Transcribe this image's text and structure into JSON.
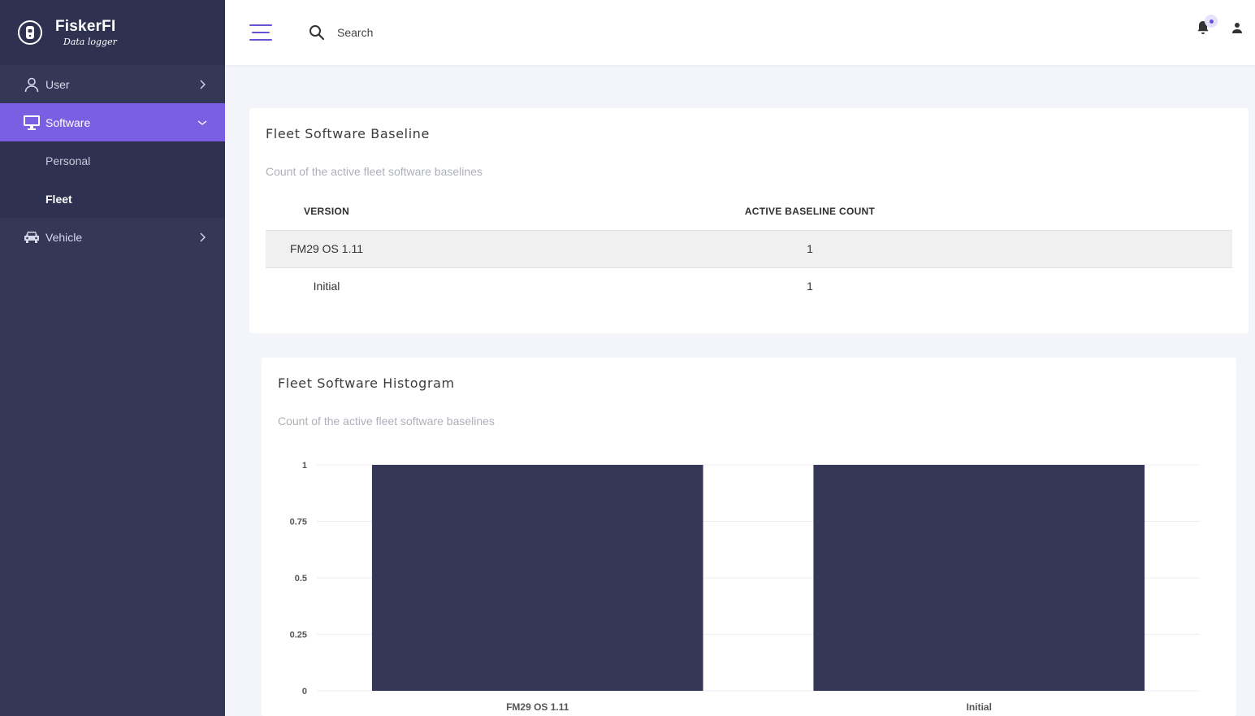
{
  "brand": {
    "name": "FiskerFI",
    "subtitle": "Data logger"
  },
  "sidebar": {
    "items": [
      {
        "label": "User",
        "icon": "user-icon",
        "expanded": false
      },
      {
        "label": "Software",
        "icon": "monitor-icon",
        "expanded": true,
        "children": [
          {
            "label": "Personal"
          },
          {
            "label": "Fleet",
            "current": true
          }
        ]
      },
      {
        "label": "Vehicle",
        "icon": "car-icon",
        "expanded": false
      }
    ]
  },
  "topbar": {
    "search_placeholder": "Search",
    "notification_badge": true
  },
  "baseline_card": {
    "title": "Fleet Software Baseline",
    "subtitle": "Count of the active fleet software baselines",
    "columns": [
      "VERSION",
      "ACTIVE BASELINE COUNT"
    ],
    "rows": [
      {
        "version": "FM29 OS 1.11",
        "count": "1"
      },
      {
        "version": "Initial",
        "count": "1"
      }
    ]
  },
  "histogram_card": {
    "title": "Fleet Software Histogram",
    "subtitle": "Count of the active fleet software baselines"
  },
  "chart_data": {
    "type": "bar",
    "categories": [
      "FM29 OS 1.11",
      "Initial"
    ],
    "values": [
      1,
      1
    ],
    "ylim": [
      0,
      1
    ],
    "yticks": [
      "0",
      "0.25",
      "0.5",
      "0.75",
      "1"
    ],
    "grid": true,
    "bar_color": "#343756"
  },
  "colors": {
    "sidebar": "#343756",
    "accent": "#7a5fe2",
    "hamburger": "#6a51d8"
  }
}
